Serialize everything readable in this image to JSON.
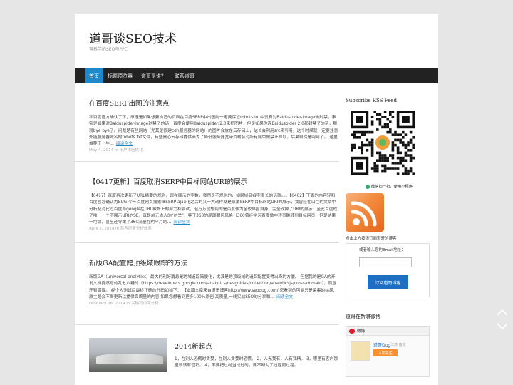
{
  "site": {
    "title": "道哥谈SEO技术",
    "tagline": "营科学的SEO与PPC"
  },
  "nav": {
    "items": [
      {
        "label": "首页",
        "active": true
      },
      {
        "label": "标题预览器",
        "active": false
      },
      {
        "label": "道哥是谁？",
        "active": false
      },
      {
        "label": "联系道哥",
        "active": false
      }
    ]
  },
  "posts": [
    {
      "title": "在百度SERP出图的注意点",
      "body": "和百度官方确认了下，原理是如果想要自己的页面在百度SERP中出图则一定要保证robots.txt中没有对Baiduspider-image做封禁，事实是如果对Baiduspider-image封禁了的话，百度会使用Baiduspider/2.0来抓图片，但是如果你连Baiduspider 2.0都封禁了的话，那就bye bye了。问题是有些网站（尤其是很建cdn服务器的网站）的图片会放在云存储上，站长会利用src来引用，这个时候就一定要注意外链服务器域名的robots.txt文件，有些黑心云存储提供商为了降低服务器宽带负载会对所有爬虫做禁止抓取，后果自然是呵呵了。 这里推荐于七牛…",
      "more": "阅读全文",
      "meta": "May 4, 2014 in 用户体验优化."
    },
    {
      "title": "【0417更新】百度取消SERP中目标网站URI的展示",
      "body": "【0417】百度再次更新了URL摘要的规则，现在展示的字数，竟然是不规则的，如果域名名字很长的话就。。。【0402】下面的内容轻和百度官方确认为BUG 今年百度网页搜索继SERP ajax化之后的又一大动作就是取消SERP中目标网站URI的展示，我曾经在以往的文章中分析及对比过百度与google在URL截断上的努力和尝试，但万万没想到的是百度作为至较早曾自身，完全砍掉了URI的展示。至此百度成了唯一一个不展示URI的SE，真是前无古人的\"创举\"，鉴于360的屁颠跟风风格（360曾经学习百度做中转页跳转到目标网页，但是结果一坨屎，甚至还导致了360流量在约半月的…",
      "more": "阅读全文",
      "meta": "April 2, 2014 in 就各层量分析体系."
    },
    {
      "title": "新版GA配置跨顶级域跟踪的方法",
      "body": "新版GA（universal analytics）最大的利好消息是跨域追踪简便化，尤其是跨顶级域的追踪配置变得出奇的方便。 但据我的是GA的开发文档竟然写的乱七八糟的（https://developers.google.com/analytics/devguides/collection/analyticsjs/cross-domain），而且还有错误。 经个人测试后最终正确的代码如如下： 【本篇文章来自道哥博客http://www.seodug.com/,您看到的可能只是采集的结果,原主题会不断更新以提供高质量的内容,如果您想看到更多100%原创,高质量,一线实战SEO的分享和…",
      "more": "阅读全文",
      "meta": "February 28, 2014 in 关键词词库分析."
    },
    {
      "title": "2014新起点",
      "body": "1，在别人恐慌时贪婪，在别人贪婪时恐慌。 2，人无我有，人有我精。 3，哪里有客户那里就该有营销。 4，不要把过时当成过时，要不断为了过程而过程。"
    }
  ],
  "sidebar": {
    "rss_title": "Subscribe RSS Feed",
    "qr_caption": "微信扫一扫，使用小程序",
    "subscribe_note": "点击上方按钮订阅道哥的博客",
    "subscribe_prompt": "或者输入您的Email地址：",
    "email_value": "",
    "subscribe_button": "订阅道哥博客",
    "weibo_title": "道哥在新浪微博",
    "weibo_label": "微博",
    "weibo_name": "道哥Dug",
    "weibo_location": "江苏 南京",
    "weibo_follow": "+加关注"
  },
  "colors": {
    "nav_bg": "#222222",
    "nav_active": "#1e88c9",
    "link": "#1e88c9",
    "button": "#1e6fc2",
    "rss_orange": "#f28a3c"
  }
}
